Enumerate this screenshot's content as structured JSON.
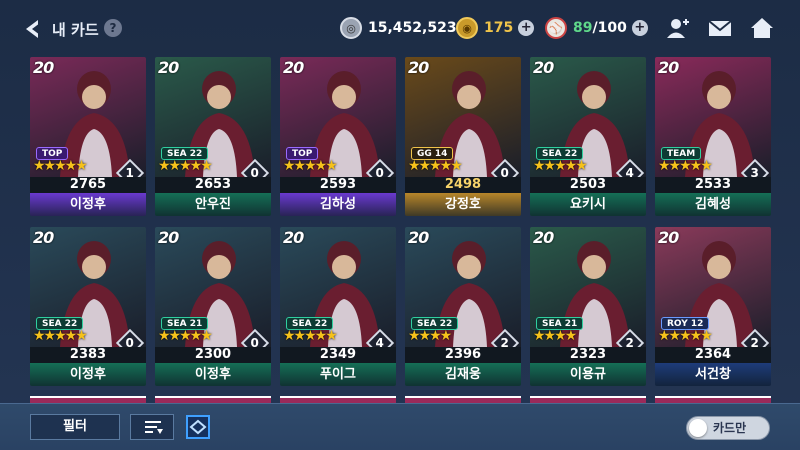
{
  "header": {
    "title": "내 카드",
    "help": "?",
    "currency_silver": "15,452,523",
    "currency_gold": "175",
    "energy": "89",
    "energy_max": "/100"
  },
  "cards": [
    {
      "year": "20",
      "tag": "TOP",
      "score": "2765",
      "name": "이정후",
      "level": "1",
      "stars": "★★★★★",
      "bg": "#7a2a58",
      "strip": "#6a3ad0"
    },
    {
      "year": "20",
      "tag": "SEA 22",
      "score": "2653",
      "name": "안우진",
      "level": "0",
      "stars": "★★★★★",
      "bg": "#2a5a4a",
      "strip": "#156f56"
    },
    {
      "year": "20",
      "tag": "TOP",
      "score": "2593",
      "name": "김하성",
      "level": "0",
      "stars": "★★★★★",
      "bg": "#7a2a58",
      "strip": "#6a3ad0"
    },
    {
      "year": "20",
      "tag": "GG 14",
      "score": "2498",
      "name": "강정호",
      "level": "0",
      "stars": "★★★★★",
      "bg": "#6a4a1a",
      "strip": "#b8862a"
    },
    {
      "year": "20",
      "tag": "SEA 22",
      "score": "2503",
      "name": "요키시",
      "level": "4",
      "stars": "★★★★★",
      "bg": "#2a5a4a",
      "strip": "#156f56"
    },
    {
      "year": "20",
      "tag": "TEAM",
      "score": "2533",
      "name": "김혜성",
      "level": "3",
      "stars": "★★★★★",
      "bg": "#8a2a5a",
      "strip": "#156f56"
    },
    {
      "year": "20",
      "tag": "SEA 22",
      "score": "2383",
      "name": "이정후",
      "level": "0",
      "stars": "★★★★★",
      "bg": "#2a4a5a",
      "strip": "#156f56"
    },
    {
      "year": "20",
      "tag": "SEA 21",
      "score": "2300",
      "name": "이정후",
      "level": "0",
      "stars": "★★★★★",
      "bg": "#2a4a5a",
      "strip": "#156f56"
    },
    {
      "year": "20",
      "tag": "SEA 22",
      "score": "2349",
      "name": "푸이그",
      "level": "4",
      "stars": "★★★★★",
      "bg": "#2a4a5a",
      "strip": "#156f56"
    },
    {
      "year": "20",
      "tag": "SEA 22",
      "score": "2396",
      "name": "김재웅",
      "level": "2",
      "stars": "★★★★",
      "bg": "#2a4a5a",
      "strip": "#156f56"
    },
    {
      "year": "20",
      "tag": "SEA 21",
      "score": "2323",
      "name": "이용규",
      "level": "2",
      "stars": "★★★★",
      "bg": "#2a5a4a",
      "strip": "#156f56"
    },
    {
      "year": "20",
      "tag": "ROY 12",
      "score": "2364",
      "name": "서건창",
      "level": "2",
      "stars": "★★★★★",
      "bg": "#8a3a5a",
      "strip": "#1e3c7a"
    }
  ],
  "footer": {
    "filter_label": "필터",
    "toggle_label": "카드만"
  },
  "colors": {
    "star": "#f6c21b",
    "accent_purple": "#6a3ad0",
    "accent_green": "#156f56",
    "accent_gold": "#b8862a"
  }
}
